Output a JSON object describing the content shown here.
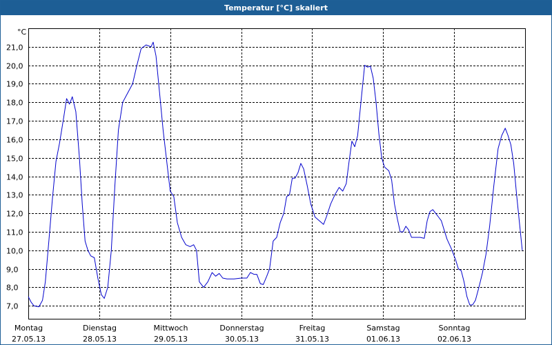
{
  "window": {
    "title": "Temperatur [°C] skaliert"
  },
  "chart_data": {
    "type": "line",
    "title": "Temperatur [°C] skaliert",
    "ylabel": "°C",
    "xlabel": "",
    "ylim": [
      6.3,
      22.0
    ],
    "yticks": [
      7.0,
      8.0,
      9.0,
      10.0,
      11.0,
      12.0,
      13.0,
      14.0,
      15.0,
      16.0,
      17.0,
      18.0,
      19.0,
      20.0,
      21.0
    ],
    "ytick_labels": [
      "7,0",
      "8,0",
      "9,0",
      "10,0",
      "11,0",
      "12,0",
      "13,0",
      "14,0",
      "15,0",
      "16,0",
      "17,0",
      "18,0",
      "19,0",
      "20,0",
      "21,0"
    ],
    "xlim": [
      0,
      7
    ],
    "xticks": [
      {
        "day": "Montag",
        "date": "27.05.13"
      },
      {
        "day": "Dienstag",
        "date": "28.05.13"
      },
      {
        "day": "Mittwoch",
        "date": "29.05.13"
      },
      {
        "day": "Donnerstag",
        "date": "30.05.13"
      },
      {
        "day": "Freitag",
        "date": "31.05.13"
      },
      {
        "day": "Samstag",
        "date": "01.06.13"
      },
      {
        "day": "Sonntag",
        "date": "02.06.13"
      }
    ],
    "grid": true,
    "color": "#0000cc",
    "series": [
      {
        "name": "",
        "points": [
          [
            0.0,
            7.5
          ],
          [
            0.04,
            7.2
          ],
          [
            0.08,
            7.0
          ],
          [
            0.15,
            6.95
          ],
          [
            0.2,
            7.3
          ],
          [
            0.24,
            8.3
          ],
          [
            0.29,
            10.5
          ],
          [
            0.34,
            12.8
          ],
          [
            0.39,
            14.8
          ],
          [
            0.44,
            15.8
          ],
          [
            0.5,
            17.2
          ],
          [
            0.54,
            18.2
          ],
          [
            0.58,
            17.9
          ],
          [
            0.62,
            18.3
          ],
          [
            0.67,
            17.5
          ],
          [
            0.72,
            15.0
          ],
          [
            0.76,
            12.5
          ],
          [
            0.8,
            10.5
          ],
          [
            0.84,
            10.0
          ],
          [
            0.88,
            9.7
          ],
          [
            0.93,
            9.6
          ],
          [
            0.98,
            8.5
          ],
          [
            1.03,
            7.6
          ],
          [
            1.07,
            7.4
          ],
          [
            1.12,
            8.0
          ],
          [
            1.17,
            10.0
          ],
          [
            1.22,
            13.5
          ],
          [
            1.27,
            16.5
          ],
          [
            1.33,
            18.0
          ],
          [
            1.4,
            18.5
          ],
          [
            1.47,
            19.0
          ],
          [
            1.53,
            20.0
          ],
          [
            1.59,
            20.9
          ],
          [
            1.66,
            21.1
          ],
          [
            1.73,
            21.0
          ],
          [
            1.76,
            21.25
          ],
          [
            1.8,
            20.5
          ],
          [
            1.85,
            18.5
          ],
          [
            1.9,
            16.5
          ],
          [
            1.96,
            14.5
          ],
          [
            2.0,
            13.2
          ],
          [
            2.05,
            12.9
          ],
          [
            2.1,
            11.5
          ],
          [
            2.16,
            10.7
          ],
          [
            2.22,
            10.3
          ],
          [
            2.28,
            10.2
          ],
          [
            2.33,
            10.3
          ],
          [
            2.37,
            10.0
          ],
          [
            2.41,
            8.3
          ],
          [
            2.47,
            8.0
          ],
          [
            2.53,
            8.3
          ],
          [
            2.59,
            8.8
          ],
          [
            2.64,
            8.6
          ],
          [
            2.69,
            8.75
          ],
          [
            2.74,
            8.5
          ],
          [
            2.8,
            8.45
          ],
          [
            2.9,
            8.45
          ],
          [
            3.0,
            8.5
          ],
          [
            3.08,
            8.5
          ],
          [
            3.13,
            8.8
          ],
          [
            3.18,
            8.7
          ],
          [
            3.22,
            8.7
          ],
          [
            3.27,
            8.2
          ],
          [
            3.31,
            8.15
          ],
          [
            3.36,
            8.6
          ],
          [
            3.4,
            9.0
          ],
          [
            3.45,
            10.5
          ],
          [
            3.5,
            10.7
          ],
          [
            3.55,
            11.5
          ],
          [
            3.6,
            12.0
          ],
          [
            3.64,
            12.9
          ],
          [
            3.68,
            13.0
          ],
          [
            3.72,
            13.9
          ],
          [
            3.76,
            13.9
          ],
          [
            3.8,
            14.2
          ],
          [
            3.84,
            14.7
          ],
          [
            3.88,
            14.4
          ],
          [
            3.93,
            13.5
          ],
          [
            3.98,
            12.5
          ],
          [
            4.04,
            11.8
          ],
          [
            4.1,
            11.6
          ],
          [
            4.16,
            11.4
          ],
          [
            4.2,
            11.8
          ],
          [
            4.26,
            12.5
          ],
          [
            4.32,
            13.0
          ],
          [
            4.38,
            13.4
          ],
          [
            4.43,
            13.2
          ],
          [
            4.48,
            13.6
          ],
          [
            4.52,
            14.8
          ],
          [
            4.56,
            15.9
          ],
          [
            4.6,
            15.6
          ],
          [
            4.64,
            16.2
          ],
          [
            4.7,
            18.5
          ],
          [
            4.74,
            20.0
          ],
          [
            4.78,
            19.9
          ],
          [
            4.82,
            19.95
          ],
          [
            4.86,
            19.3
          ],
          [
            4.9,
            18.0
          ],
          [
            4.94,
            16.3
          ],
          [
            4.98,
            15.0
          ],
          [
            5.02,
            14.5
          ],
          [
            5.08,
            14.3
          ],
          [
            5.12,
            13.8
          ],
          [
            5.16,
            12.5
          ],
          [
            5.2,
            11.7
          ],
          [
            5.24,
            11.0
          ],
          [
            5.28,
            11.0
          ],
          [
            5.32,
            11.3
          ],
          [
            5.36,
            11.1
          ],
          [
            5.4,
            10.7
          ],
          [
            5.46,
            10.7
          ],
          [
            5.52,
            10.7
          ],
          [
            5.58,
            10.65
          ],
          [
            5.62,
            11.6
          ],
          [
            5.66,
            12.1
          ],
          [
            5.7,
            12.2
          ],
          [
            5.74,
            12.0
          ],
          [
            5.78,
            11.8
          ],
          [
            5.82,
            11.6
          ],
          [
            5.86,
            11.1
          ],
          [
            5.9,
            10.6
          ],
          [
            5.96,
            10.1
          ],
          [
            6.02,
            9.5
          ],
          [
            6.06,
            9.0
          ],
          [
            6.1,
            8.9
          ],
          [
            6.14,
            8.3
          ],
          [
            6.18,
            7.5
          ],
          [
            6.22,
            7.05
          ],
          [
            6.26,
            7.05
          ],
          [
            6.3,
            7.3
          ],
          [
            6.35,
            8.0
          ],
          [
            6.4,
            8.8
          ],
          [
            6.45,
            9.8
          ],
          [
            6.5,
            11.3
          ],
          [
            6.56,
            13.5
          ],
          [
            6.62,
            15.5
          ],
          [
            6.67,
            16.2
          ],
          [
            6.72,
            16.6
          ],
          [
            6.76,
            16.2
          ],
          [
            6.8,
            15.7
          ],
          [
            6.84,
            14.7
          ],
          [
            6.88,
            13.0
          ],
          [
            6.92,
            11.5
          ],
          [
            6.96,
            10.0
          ]
        ]
      }
    ]
  }
}
